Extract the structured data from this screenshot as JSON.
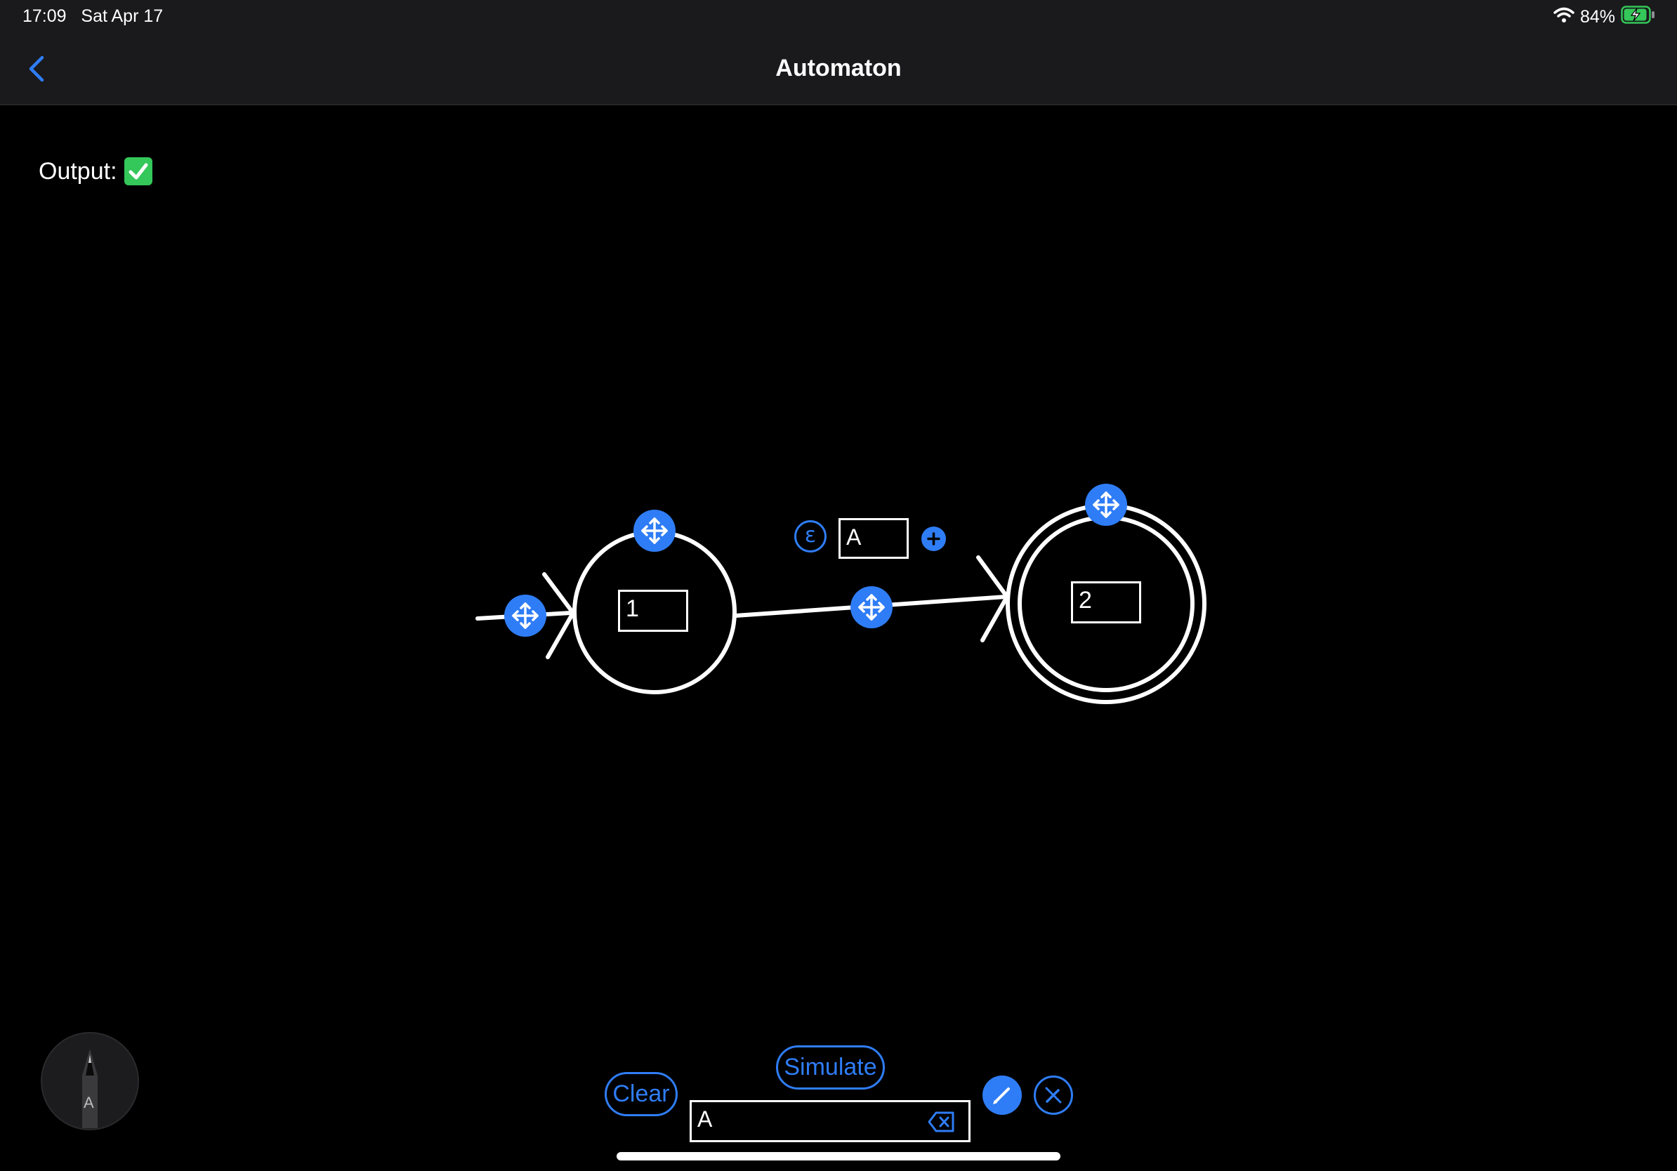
{
  "status_bar": {
    "time": "17:09",
    "date": "Sat Apr 17",
    "battery": "84%"
  },
  "nav": {
    "title": "Automaton"
  },
  "output": {
    "label": "Output:",
    "status_icon": "check-mark-icon"
  },
  "states": [
    {
      "label": "1",
      "initial": true,
      "accepting": false
    },
    {
      "label": "2",
      "initial": false,
      "accepting": true
    }
  ],
  "transition": {
    "from": "1",
    "to": "2",
    "symbol": "A",
    "epsilon_label": "ε"
  },
  "controls": {
    "clear_label": "Clear",
    "simulate_label": "Simulate",
    "input_value": "A"
  },
  "pencil_tool": {
    "label": "A"
  },
  "colors": {
    "accent": "#2f7df6",
    "success": "#34c759",
    "background": "#000000",
    "bar": "#1a1a1c"
  }
}
